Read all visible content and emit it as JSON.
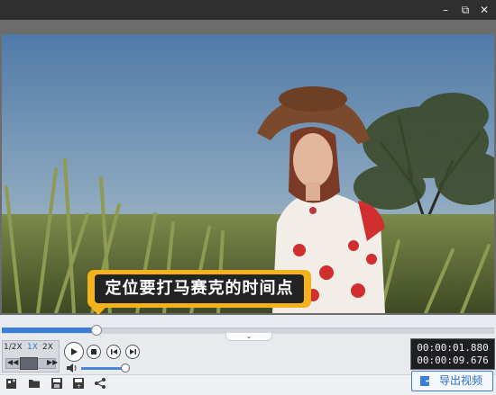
{
  "window": {
    "minimize_glyph": "–",
    "maximize_glyph": "⧉",
    "close_glyph": "✕"
  },
  "video": {
    "subtitle_text": "定位要打马赛克的时间点"
  },
  "playback": {
    "progress_fraction": 0.19,
    "speed_options": [
      "1/2X",
      "1X",
      "2X"
    ],
    "speed_selected": "1X",
    "current_time": "00:00:01.880",
    "total_time": "00:00:09.676",
    "volume_fraction": 0.92
  },
  "toolbar": {
    "export_label": "导出视频",
    "icons": [
      "add-file-icon",
      "open-folder-icon",
      "save-icon",
      "save-as-icon",
      "share-icon"
    ]
  },
  "colors": {
    "accent": "#3a7fd5",
    "tooltip": "#f5b21a",
    "titlebar": "#2f2f2f"
  }
}
